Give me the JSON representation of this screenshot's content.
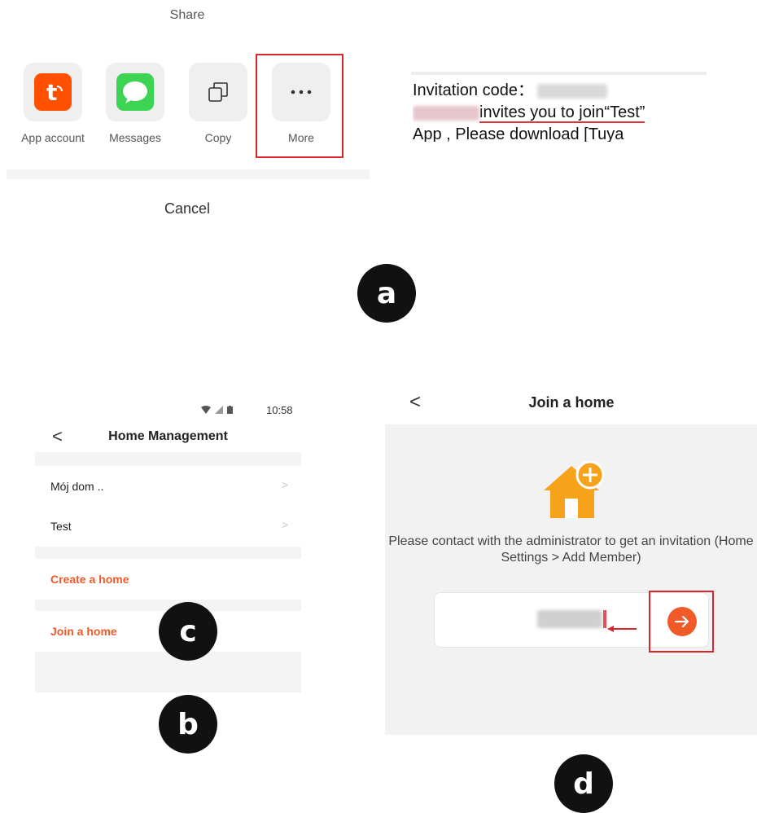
{
  "share_sheet": {
    "title": "Share",
    "items": [
      {
        "label": "App account",
        "icon": "tuya-app-icon"
      },
      {
        "label": "Messages",
        "icon": "messages-icon"
      },
      {
        "label": "Copy",
        "icon": "copy-icon"
      },
      {
        "label": "More",
        "icon": "more-icon"
      }
    ],
    "cancel_label": "Cancel"
  },
  "message_preview": {
    "line1_prefix": "Invitation code：",
    "line2_suffix": "invites you to join“Test”",
    "line3": "App , Please download [Tuya"
  },
  "step_labels": {
    "a": "a",
    "b": "b",
    "c": "c",
    "d": "d"
  },
  "home_management": {
    "status_time": "10:58",
    "back": "<",
    "title": "Home Management",
    "homes": [
      "Mój dom ..",
      "Test"
    ],
    "actions": [
      "Create a home",
      "Join a home"
    ]
  },
  "join_home": {
    "back": "<",
    "title": "Join a home",
    "instructions": "Please contact with the administrator to get an invitation (Home Settings > Add Member)"
  },
  "colors": {
    "accent": "#f05a28",
    "highlight_red": "#d9262c",
    "tuya_orange": "#ff4f00",
    "messages_green": "#3ed453",
    "house_orange": "#f7a21b"
  }
}
